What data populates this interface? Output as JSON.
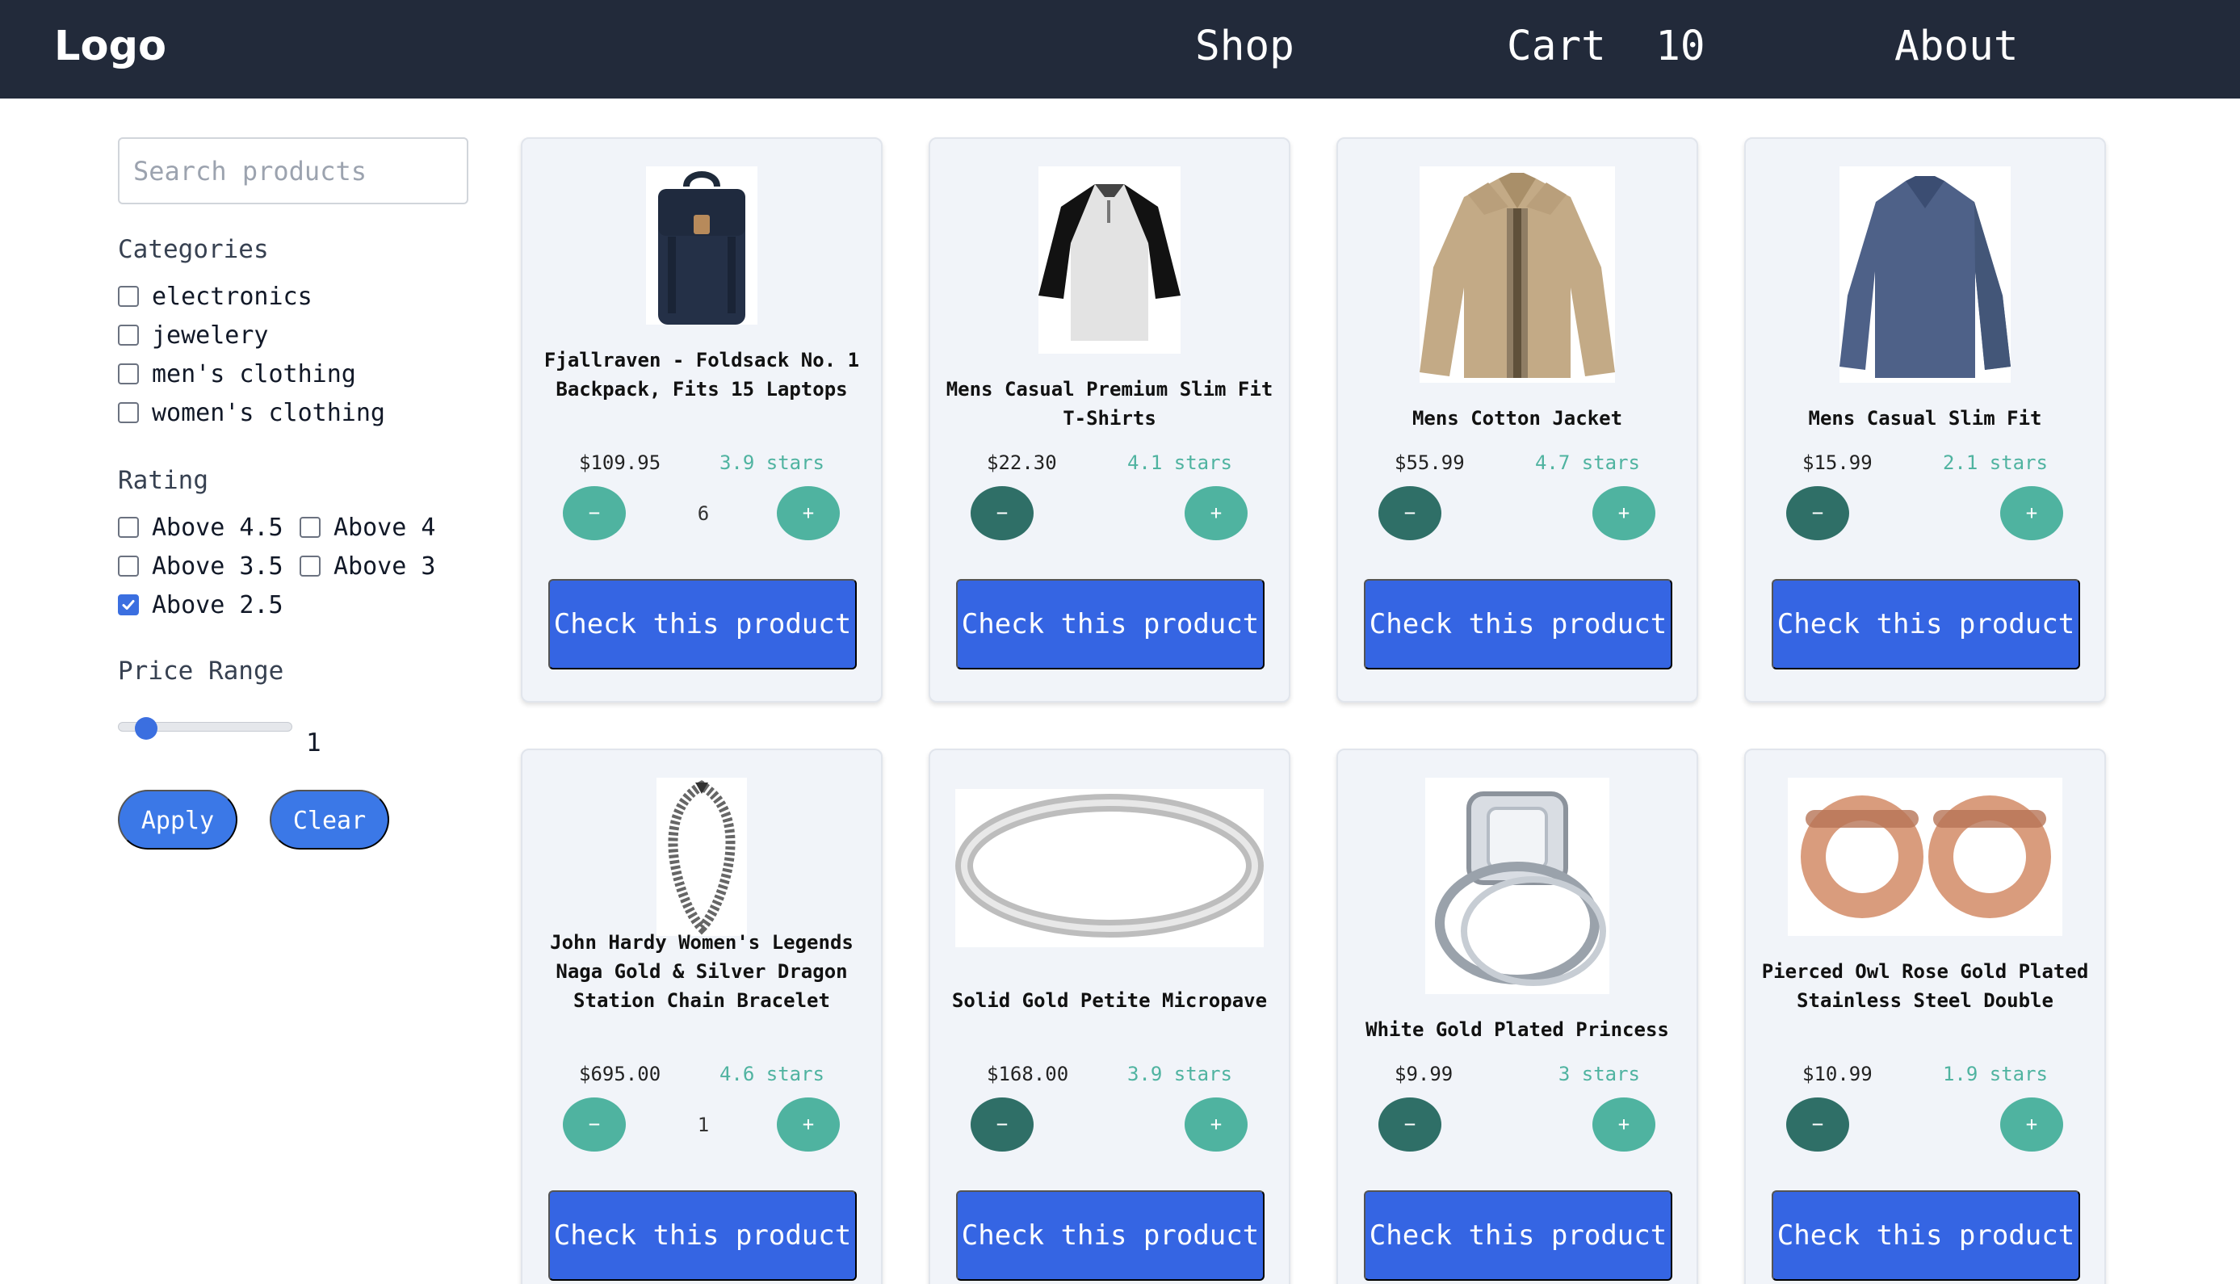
{
  "header": {
    "logo": "Logo",
    "nav": {
      "shop": "Shop",
      "cart": "Cart  10",
      "about": "About"
    }
  },
  "sidebar": {
    "search_placeholder": "Search products",
    "categories_title": "Categories",
    "categories": [
      "electronics",
      "jewelery",
      "men's clothing",
      "women's clothing"
    ],
    "rating_title": "Rating",
    "ratings": [
      {
        "label": "Above 4.5",
        "checked": false
      },
      {
        "label": "Above 4",
        "checked": false
      },
      {
        "label": "Above 3.5",
        "checked": false
      },
      {
        "label": "Above 3",
        "checked": false
      },
      {
        "label": "Above 2.5",
        "checked": true
      }
    ],
    "price_title": "Price Range",
    "price_value": "1",
    "apply": "Apply",
    "clear": "Clear"
  },
  "products": [
    {
      "title": "Fjallraven - Foldsack No. 1 Backpack, Fits 15 Laptops",
      "price": "$109.95",
      "stars": "3.9 stars",
      "qty": "6",
      "cta": "Check this product",
      "image": "backpack"
    },
    {
      "title": "Mens Casual Premium Slim Fit T-Shirts",
      "price": "$22.30",
      "stars": "4.1 stars",
      "qty": "",
      "cta": "Check this product",
      "image": "raglan-shirt"
    },
    {
      "title": "Mens Cotton Jacket",
      "price": "$55.99",
      "stars": "4.7 stars",
      "qty": "",
      "cta": "Check this product",
      "image": "jacket"
    },
    {
      "title": "Mens Casual Slim Fit",
      "price": "$15.99",
      "stars": "2.1 stars",
      "qty": "",
      "cta": "Check this product",
      "image": "long-sleeve-shirt"
    },
    {
      "title": "John Hardy Women's Legends Naga Gold & Silver Dragon Station Chain Bracelet",
      "price": "$695.00",
      "stars": "4.6 stars",
      "qty": "1",
      "cta": "Check this product",
      "image": "bracelet"
    },
    {
      "title": "Solid Gold Petite Micropave",
      "price": "$168.00",
      "stars": "3.9 stars",
      "qty": "",
      "cta": "Check this product",
      "image": "ring-band"
    },
    {
      "title": "White Gold Plated Princess",
      "price": "$9.99",
      "stars": "3 stars",
      "qty": "",
      "cta": "Check this product",
      "image": "engagement-ring"
    },
    {
      "title": "Pierced Owl Rose Gold Plated Stainless Steel Double",
      "price": "$10.99",
      "stars": "1.9 stars",
      "qty": "",
      "cta": "Check this product",
      "image": "rose-gold-tunnels"
    }
  ],
  "colors": {
    "header_bg": "#222a3a",
    "card_bg": "#f1f4f9",
    "accent": "#3565e3",
    "teal": "#4fb3a0",
    "dark_teal": "#2f6f67"
  }
}
